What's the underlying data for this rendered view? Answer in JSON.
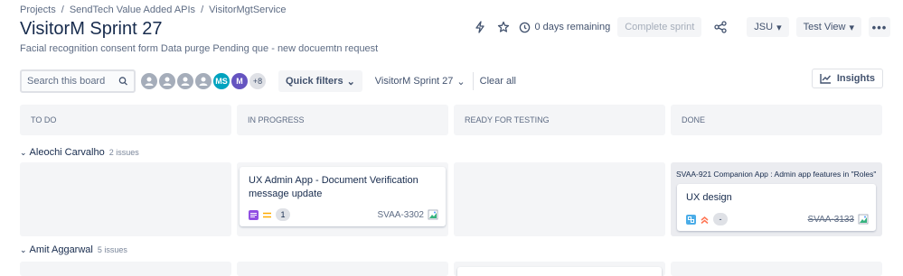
{
  "breadcrumb": [
    "Projects",
    "SendTech Value Added APIs",
    "VisitorMgtService"
  ],
  "title": "VisitorM Sprint 27",
  "sprint_goal": "Facial recognition consent form Data purge Pending que - new docuemtn request",
  "header": {
    "days_remaining": "0 days remaining",
    "complete_sprint": "Complete sprint",
    "user_select": "JSU",
    "view_select": "Test View"
  },
  "toolbar": {
    "search_placeholder": "Search this board",
    "avatars": [
      "",
      "",
      "",
      "",
      "MS",
      "M",
      "+8"
    ],
    "quick_filters": "Quick filters",
    "sprint_filter": "VisitorM Sprint 27",
    "clear_all": "Clear all",
    "insights": "Insights"
  },
  "columns": [
    "TO DO",
    "IN PROGRESS",
    "READY FOR TESTING",
    "DONE"
  ],
  "swimlanes": [
    {
      "name": "Aleochi Carvalho",
      "count": "2 issues",
      "cards": [
        {
          "summary": "UX Admin App - Document Verification message update",
          "estimate": "1",
          "key": "SVAA-3302"
        },
        {
          "parent": "SVAA-921 Companion App : Admin app features in \"Roles\"",
          "summary": "UX design",
          "estimate": "-",
          "key": "SVAA-3133"
        }
      ]
    },
    {
      "name": "Amit Aggarwal",
      "count": "5 issues"
    }
  ],
  "colors": {
    "story": "#904ee2",
    "priority_medium": "#ffab00",
    "subtask": "#4bade8",
    "priority_high": "#ff7452",
    "avatar_teal": "#00a3bf",
    "avatar_purple": "#6554c0"
  }
}
